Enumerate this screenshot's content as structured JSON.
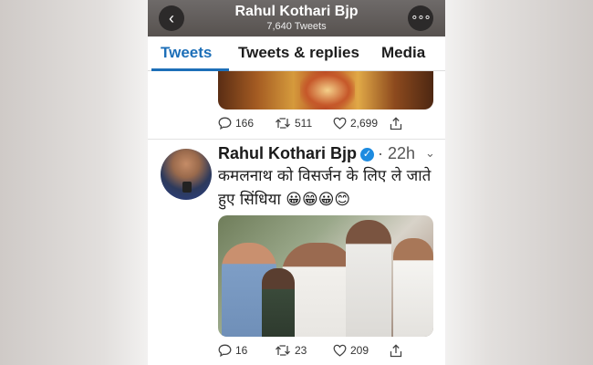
{
  "header": {
    "title": "Rahul Kothari Bjp",
    "subtitle": "7,640 Tweets",
    "back_icon": "‹",
    "more_icon": "∘∘∘"
  },
  "tabs": [
    {
      "label": "Tweets",
      "active": true
    },
    {
      "label": "Tweets & replies",
      "active": false
    },
    {
      "label": "Media",
      "active": false
    }
  ],
  "accent_color": "#1d6fb8",
  "prev_tweet": {
    "replies": "166",
    "retweets": "511",
    "likes": "2,699"
  },
  "tweet": {
    "author": "Rahul Kothari Bjp",
    "time": "22h",
    "text": "कमलनाथ को विसर्जन के लिए ले जाते हुए सिंधिया 😀😁😀😊",
    "replies": "16",
    "retweets": "23",
    "likes": "209"
  },
  "icons": {
    "reply": "comment-icon",
    "retweet": "retweet-icon",
    "like": "heart-icon",
    "share": "share-icon",
    "verified": "verified-badge-icon",
    "caret": "chevron-down-icon"
  }
}
